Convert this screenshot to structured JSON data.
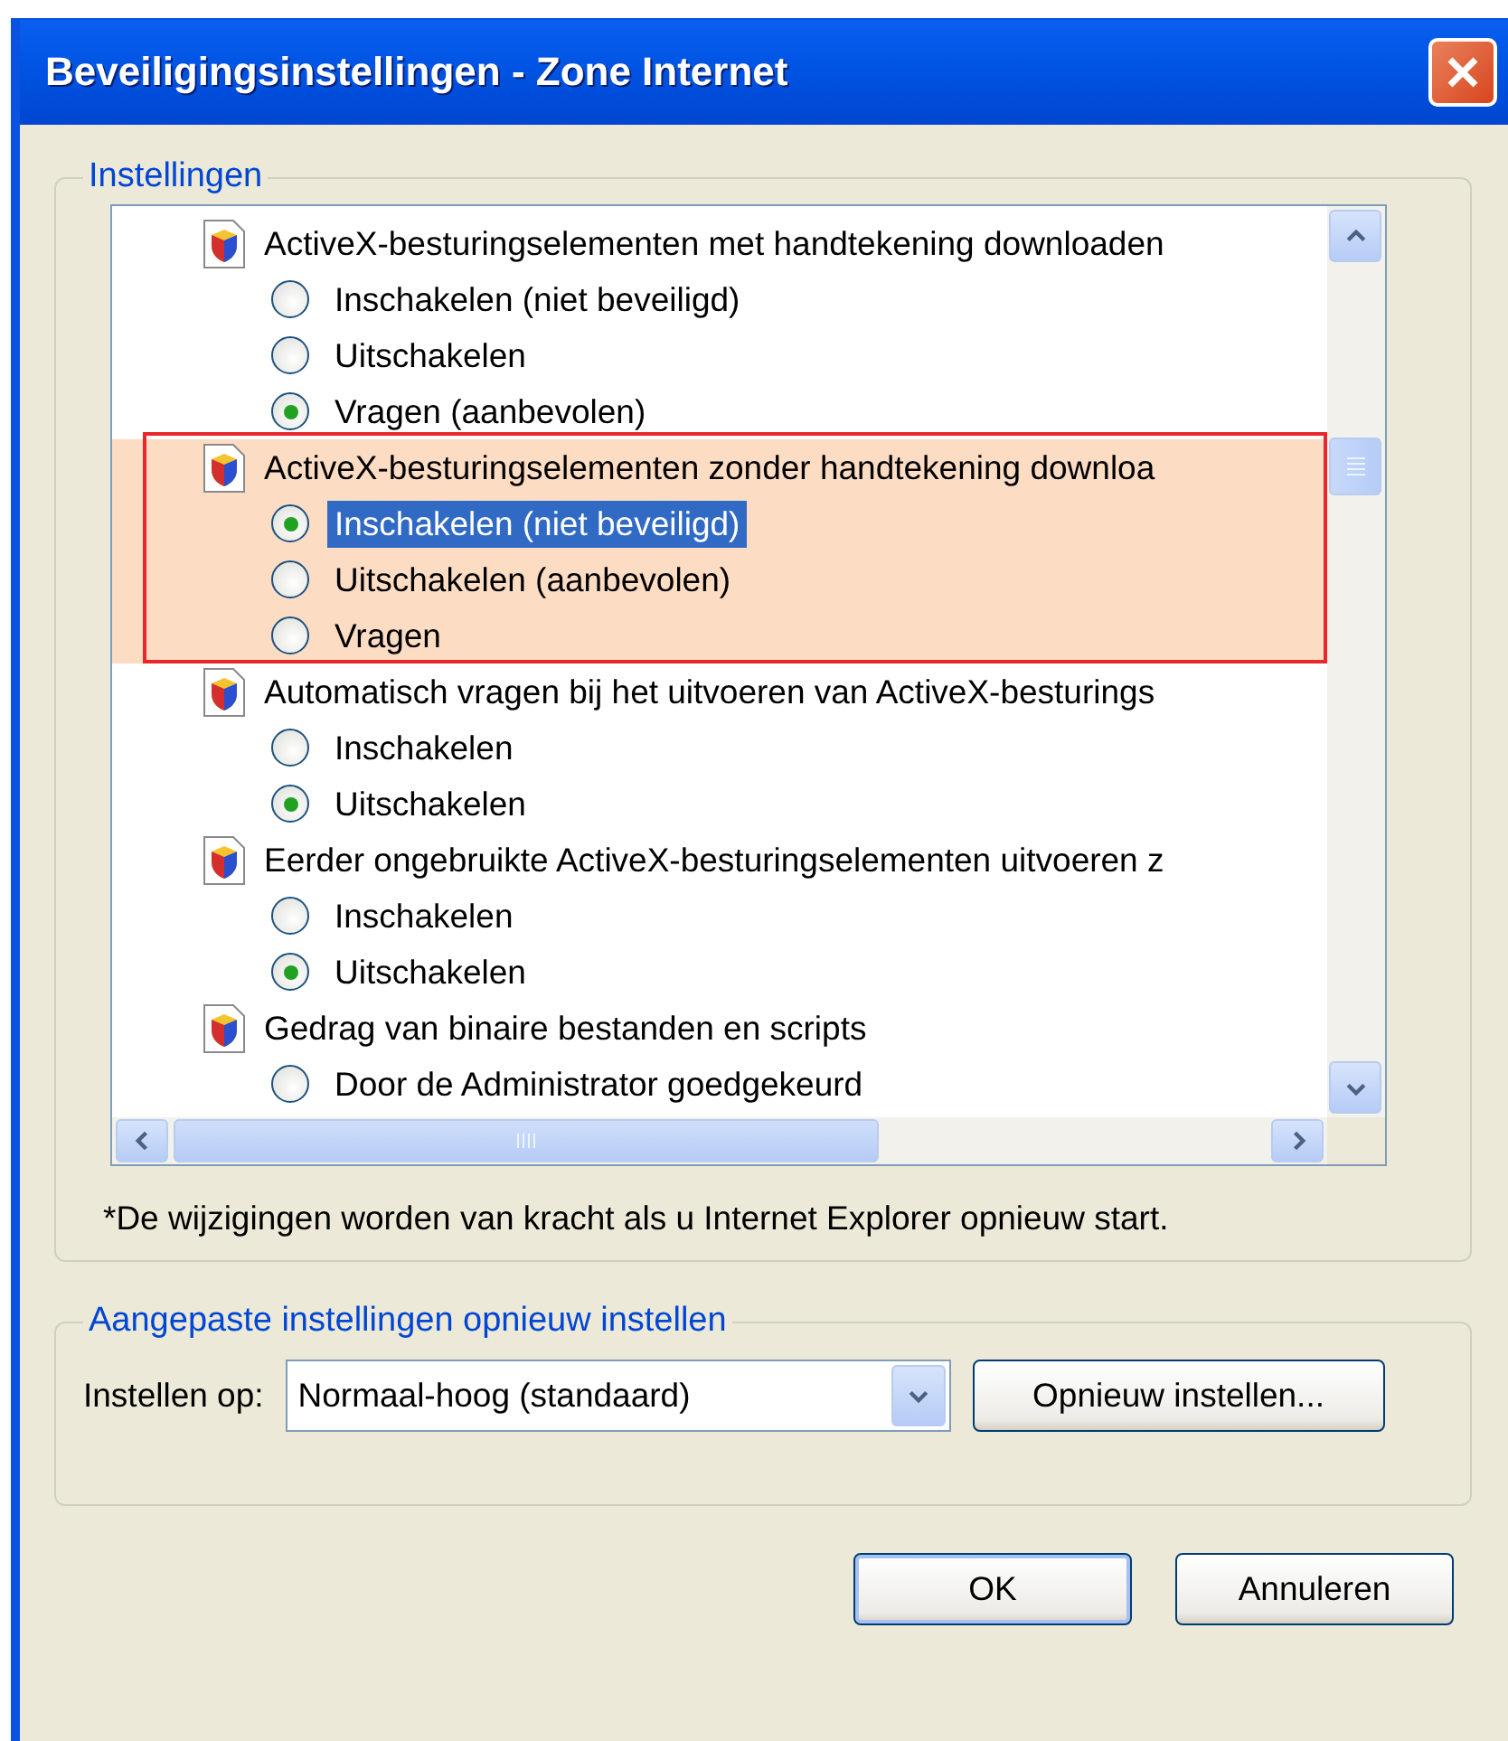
{
  "window": {
    "title": "Beveiligingsinstellingen - Zone Internet"
  },
  "settings_group": {
    "label": "Instellingen",
    "items": [
      {
        "title": "ActiveX-besturingselementen met handtekening downloaden",
        "highlighted": false,
        "options": [
          {
            "label": "Inschakelen (niet beveiligd)",
            "selected": false,
            "focused": false
          },
          {
            "label": "Uitschakelen",
            "selected": false,
            "focused": false
          },
          {
            "label": "Vragen (aanbevolen)",
            "selected": true,
            "focused": false
          }
        ]
      },
      {
        "title": "ActiveX-besturingselementen zonder handtekening downloa",
        "highlighted": true,
        "options": [
          {
            "label": "Inschakelen (niet beveiligd)",
            "selected": true,
            "focused": true
          },
          {
            "label": "Uitschakelen (aanbevolen)",
            "selected": false,
            "focused": false
          },
          {
            "label": "Vragen",
            "selected": false,
            "focused": false
          }
        ]
      },
      {
        "title": "Automatisch vragen bij het uitvoeren van ActiveX-besturings",
        "highlighted": false,
        "options": [
          {
            "label": "Inschakelen",
            "selected": false,
            "focused": false
          },
          {
            "label": "Uitschakelen",
            "selected": true,
            "focused": false
          }
        ]
      },
      {
        "title": "Eerder ongebruikte ActiveX-besturingselementen uitvoeren z",
        "highlighted": false,
        "options": [
          {
            "label": "Inschakelen",
            "selected": false,
            "focused": false
          },
          {
            "label": "Uitschakelen",
            "selected": true,
            "focused": false
          }
        ]
      },
      {
        "title": "Gedrag van binaire bestanden en scripts",
        "highlighted": false,
        "options": [
          {
            "label": "Door de Administrator goedgekeurd",
            "selected": false,
            "focused": false
          }
        ]
      }
    ],
    "note": "*De wijzigingen worden van kracht als u Internet Explorer opnieuw start."
  },
  "reset_group": {
    "label": "Aangepaste instellingen opnieuw instellen",
    "field_label": "Instellen op:",
    "value": "Normaal-hoog (standaard)",
    "button": "Opnieuw instellen..."
  },
  "buttons": [
    {
      "label": "OK",
      "default": true
    },
    {
      "label": "Annuleren",
      "default": false
    }
  ]
}
